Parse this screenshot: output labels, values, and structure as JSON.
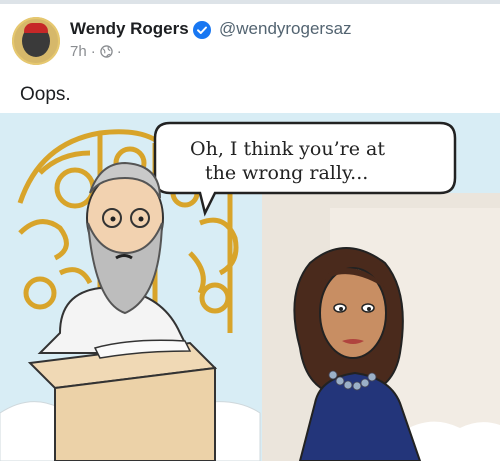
{
  "post": {
    "author_name": "Wendy Rogers",
    "handle": "@wendyrogersaz",
    "time": "7h",
    "separator": "·",
    "text": "Oops.",
    "verified_color": "#1877f2"
  },
  "comic": {
    "speech_line1": "Oh, I think you’re at",
    "speech_line2": "the wrong rally..."
  }
}
